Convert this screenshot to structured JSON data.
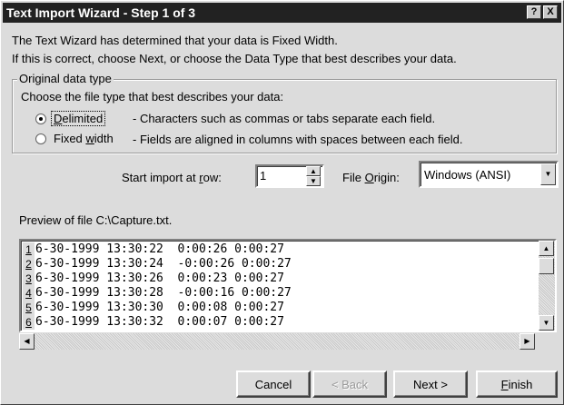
{
  "window": {
    "title": "Text Import Wizard - Step 1 of 3",
    "help_glyph": "?",
    "close_glyph": "X"
  },
  "intro": {
    "line1": "The Text Wizard has determined that your data is Fixed Width.",
    "line2": "If this is correct, choose Next, or choose the Data Type that best describes your data."
  },
  "data_type_group": {
    "legend": "Original data type",
    "prompt": "Choose the file type that best describes your data:",
    "options": [
      {
        "label_pre": "",
        "label_u": "D",
        "label_post": "elimited",
        "description": "- Characters such as commas or tabs separate each field.",
        "checked": true
      },
      {
        "label_pre": "Fixed ",
        "label_u": "w",
        "label_post": "idth",
        "description": "- Fields are aligned in columns with spaces between each field.",
        "checked": false
      }
    ]
  },
  "import_row": {
    "label_pre": "Start import at ",
    "label_u": "r",
    "label_post": "ow:",
    "value": "1"
  },
  "file_origin": {
    "label_pre": "File ",
    "label_u": "O",
    "label_post": "rigin:",
    "value": "Windows (ANSI)"
  },
  "preview": {
    "label": "Preview of file C:\\Capture.txt.",
    "rows": [
      {
        "num": "1",
        "text": "6-30-1999 13:30:22  0:00:26 0:00:27"
      },
      {
        "num": "2",
        "text": "6-30-1999 13:30:24  -0:00:26 0:00:27"
      },
      {
        "num": "3",
        "text": "6-30-1999 13:30:26  0:00:23 0:00:27"
      },
      {
        "num": "4",
        "text": "6-30-1999 13:30:28  -0:00:16 0:00:27"
      },
      {
        "num": "5",
        "text": "6-30-1999 13:30:30  0:00:08 0:00:27"
      },
      {
        "num": "6",
        "text": "6-30-1999 13:30:32  0:00:07 0:00:27"
      }
    ]
  },
  "buttons": {
    "cancel": "Cancel",
    "back": "< Back",
    "next": "Next >",
    "finish_u": "F",
    "finish_post": "inish"
  }
}
